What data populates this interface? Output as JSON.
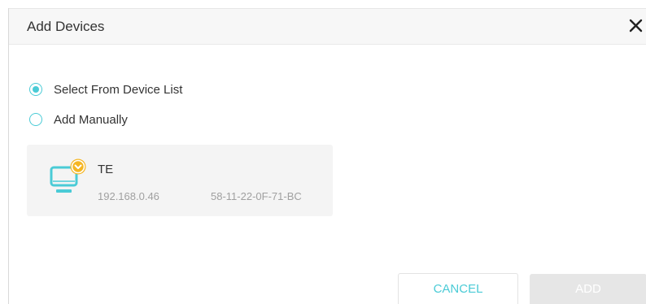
{
  "dialog": {
    "title": "Add Devices",
    "close_icon": "close-icon"
  },
  "options": [
    {
      "label": "Select From Device List",
      "selected": true
    },
    {
      "label": "Add Manually",
      "selected": false
    }
  ],
  "devices": [
    {
      "name": "TE",
      "ip": "192.168.0.46",
      "mac": "58-11-22-0F-71-BC",
      "icon": "computer-monitor-icon",
      "badge_icon": "unknown-device-badge-icon"
    }
  ],
  "buttons": {
    "cancel": "CANCEL",
    "add": "ADD",
    "add_enabled": false
  },
  "colors": {
    "accent": "#4acbd6",
    "badge": "#f5b624",
    "disabled_button": "#e6e6e6"
  }
}
